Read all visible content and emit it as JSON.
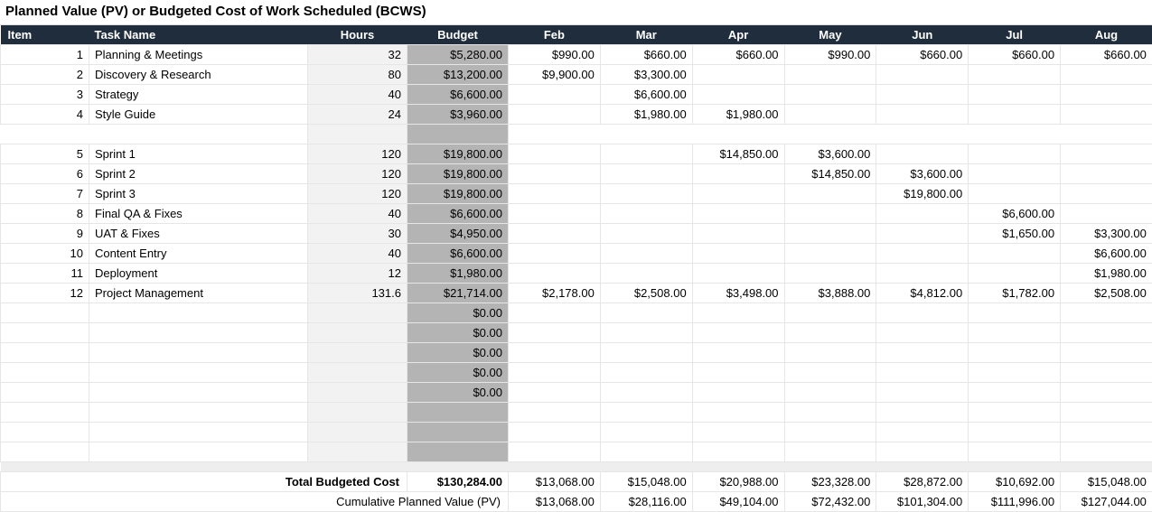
{
  "title": "Planned Value (PV) or Budgeted Cost of Work Scheduled (BCWS)",
  "headers": {
    "item": "Item",
    "task": "Task Name",
    "hours": "Hours",
    "budget": "Budget",
    "months": [
      "Feb",
      "Mar",
      "Apr",
      "May",
      "Jun",
      "Jul",
      "Aug"
    ]
  },
  "rows": [
    {
      "n": "1",
      "task": "Planning & Meetings",
      "hours": "32",
      "budget": "$5,280.00",
      "m": [
        "$990.00",
        "$660.00",
        "$660.00",
        "$990.00",
        "$660.00",
        "$660.00",
        "$660.00"
      ]
    },
    {
      "n": "2",
      "task": "Discovery & Research",
      "hours": "80",
      "budget": "$13,200.00",
      "m": [
        "$9,900.00",
        "$3,300.00",
        "",
        "",
        "",
        "",
        ""
      ]
    },
    {
      "n": "3",
      "task": "Strategy",
      "hours": "40",
      "budget": "$6,600.00",
      "m": [
        "",
        "$6,600.00",
        "",
        "",
        "",
        "",
        ""
      ]
    },
    {
      "n": "4",
      "task": "Style Guide",
      "hours": "24",
      "budget": "$3,960.00",
      "m": [
        "",
        "$1,980.00",
        "$1,980.00",
        "",
        "",
        "",
        ""
      ]
    },
    {
      "n": "5",
      "task": "Sprint 1",
      "hours": "120",
      "budget": "$19,800.00",
      "gap": true,
      "m": [
        "",
        "",
        "$14,850.00",
        "$3,600.00",
        "",
        "",
        ""
      ]
    },
    {
      "n": "6",
      "task": "Sprint 2",
      "hours": "120",
      "budget": "$19,800.00",
      "m": [
        "",
        "",
        "",
        "$14,850.00",
        "$3,600.00",
        "",
        ""
      ]
    },
    {
      "n": "7",
      "task": "Sprint 3",
      "hours": "120",
      "budget": "$19,800.00",
      "m": [
        "",
        "",
        "",
        "",
        "$19,800.00",
        "",
        ""
      ]
    },
    {
      "n": "8",
      "task": "Final QA & Fixes",
      "hours": "40",
      "budget": "$6,600.00",
      "m": [
        "",
        "",
        "",
        "",
        "",
        "$6,600.00",
        ""
      ]
    },
    {
      "n": "9",
      "task": "UAT & Fixes",
      "hours": "30",
      "budget": "$4,950.00",
      "m": [
        "",
        "",
        "",
        "",
        "",
        "$1,650.00",
        "$3,300.00"
      ]
    },
    {
      "n": "10",
      "task": "Content Entry",
      "hours": "40",
      "budget": "$6,600.00",
      "m": [
        "",
        "",
        "",
        "",
        "",
        "",
        "$6,600.00"
      ]
    },
    {
      "n": "11",
      "task": "Deployment",
      "hours": "12",
      "budget": "$1,980.00",
      "m": [
        "",
        "",
        "",
        "",
        "",
        "",
        "$1,980.00"
      ]
    },
    {
      "n": "12",
      "task": "Project Management",
      "hours": "131.6",
      "budget": "$21,714.00",
      "m": [
        "$2,178.00",
        "$2,508.00",
        "$3,498.00",
        "$3,888.00",
        "$4,812.00",
        "$1,782.00",
        "$2,508.00"
      ]
    }
  ],
  "empty_budget_rows": [
    "$0.00",
    "$0.00",
    "$0.00",
    "$0.00",
    "$0.00"
  ],
  "totals": {
    "label1": "Total Budgeted Cost",
    "grand": "$130,284.00",
    "permonth": [
      "$13,068.00",
      "$15,048.00",
      "$20,988.00",
      "$23,328.00",
      "$28,872.00",
      "$10,692.00",
      "$15,048.00"
    ],
    "label2": "Cumulative Planned Value (PV)",
    "cumulative": [
      "$13,068.00",
      "$28,116.00",
      "$49,104.00",
      "$72,432.00",
      "$101,304.00",
      "$111,996.00",
      "$127,044.00"
    ]
  }
}
